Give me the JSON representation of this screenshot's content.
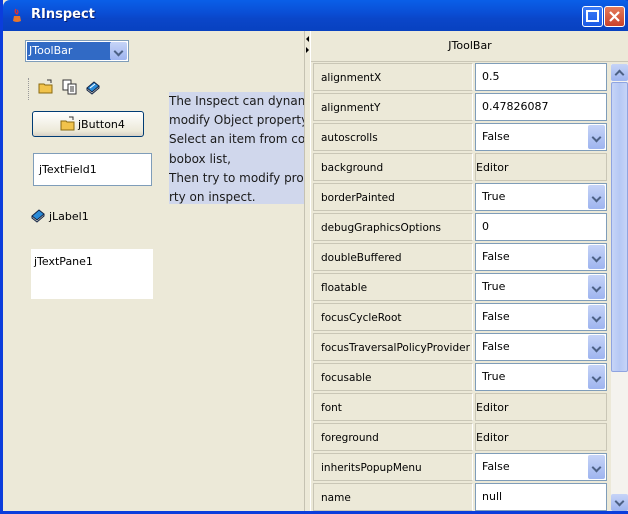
{
  "window": {
    "title": "RInspect"
  },
  "left": {
    "component_select": "JToolBar",
    "button_label": "jButton4",
    "textfield_value": "jTextField1",
    "label_text": "jLabel1",
    "textpane_value": "jTextPane1",
    "note_lines": [
      "The Inspect can dynam",
      "modify Object property.",
      " Select an item from co",
      "bobox list,",
      "  Then try to modify pro",
      "rty on inspect."
    ]
  },
  "inspector": {
    "header": "JToolBar",
    "properties": [
      {
        "name": "alignmentX",
        "value": "0.5",
        "kind": "input"
      },
      {
        "name": "alignmentY",
        "value": "0.47826087",
        "kind": "input"
      },
      {
        "name": "autoscrolls",
        "value": "False",
        "kind": "combo"
      },
      {
        "name": "background",
        "value": "Editor",
        "kind": "editor"
      },
      {
        "name": "borderPainted",
        "value": "True",
        "kind": "combo"
      },
      {
        "name": "debugGraphicsOptions",
        "value": "0",
        "kind": "input"
      },
      {
        "name": "doubleBuffered",
        "value": "False",
        "kind": "combo"
      },
      {
        "name": "floatable",
        "value": "True",
        "kind": "combo"
      },
      {
        "name": "focusCycleRoot",
        "value": "False",
        "kind": "combo"
      },
      {
        "name": "focusTraversalPolicyProvider",
        "value": "False",
        "kind": "combo"
      },
      {
        "name": "focusable",
        "value": "True",
        "kind": "combo"
      },
      {
        "name": "font",
        "value": "Editor",
        "kind": "editor"
      },
      {
        "name": "foreground",
        "value": "Editor",
        "kind": "editor"
      },
      {
        "name": "inheritsPopupMenu",
        "value": "False",
        "kind": "combo"
      },
      {
        "name": "name",
        "value": "null",
        "kind": "input"
      }
    ]
  },
  "icons": [
    "app-icon",
    "open-folder-icon",
    "copy-icon",
    "book-icon",
    "minimize-icon",
    "maximize-icon",
    "close-icon"
  ]
}
